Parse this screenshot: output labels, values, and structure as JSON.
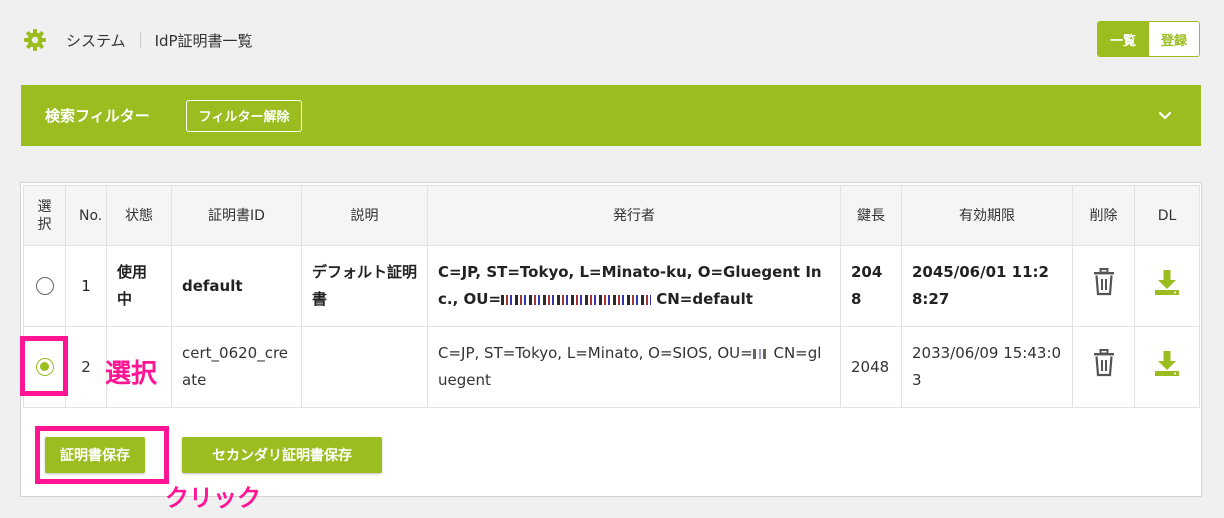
{
  "breadcrumb": {
    "section": "システム",
    "page": "IdP証明書一覧"
  },
  "view_toggle": {
    "list_label": "一覧",
    "register_label": "登録"
  },
  "filter": {
    "title": "検索フィルター",
    "clear_label": "フィルター解除"
  },
  "table": {
    "headers": {
      "select": "選択",
      "no": "No.",
      "status": "状態",
      "cert_id": "証明書ID",
      "description": "説明",
      "issuer": "発行者",
      "key_length": "鍵長",
      "expiry": "有効期限",
      "delete": "削除",
      "download": "DL"
    },
    "rows": [
      {
        "no": "1",
        "status": "使用中",
        "cert_id": "default",
        "description": "デフォルト証明書",
        "issuer_prefix": "C=JP, ST=Tokyo, L=Minato-ku, O=Gluegent Inc., OU=",
        "issuer_suffix": " CN=default",
        "key_length": "2048",
        "expiry": "2045/06/01 11:28:27",
        "selected": false
      },
      {
        "no": "2",
        "status": "",
        "cert_id": "cert_0620_create",
        "description": "",
        "issuer_prefix": "C=JP, ST=Tokyo, L=Minato, O=SIOS, OU=",
        "issuer_suffix": " CN=gluegent",
        "key_length": "2048",
        "expiry": "2033/06/09 15:43:03",
        "selected": true
      }
    ]
  },
  "buttons": {
    "save_label": "証明書保存",
    "secondary_save_label": "セカンダリ証明書保存"
  },
  "annotations": {
    "select": "選択",
    "click": "クリック"
  },
  "colors": {
    "accent": "#9bbd1f",
    "highlight": "#ff1493",
    "background": "#f0f0f0"
  },
  "icons": {
    "settings": "gear-icon",
    "collapse": "chevron-down-icon",
    "delete": "trash-icon",
    "download": "download-icon"
  }
}
